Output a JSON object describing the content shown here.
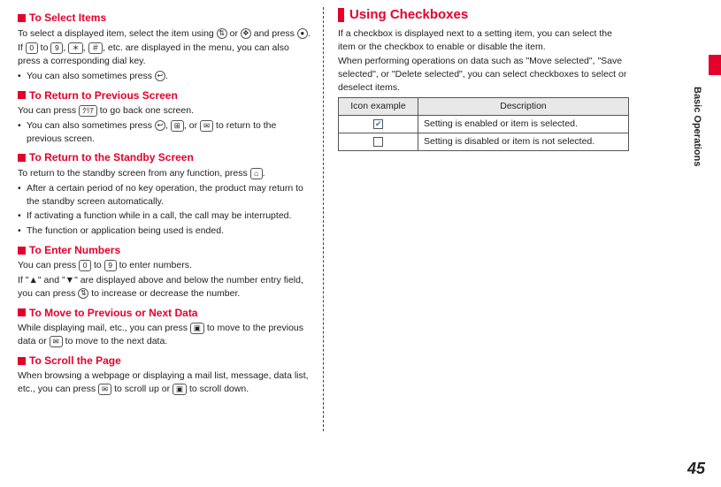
{
  "left": {
    "s1": {
      "title": "To Select Items",
      "p1a": "To select a displayed item, select the item using ",
      "p1b": " or ",
      "p1c": " and press ",
      "p1d": ".",
      "p2a": "If ",
      "p2b": " to ",
      "p2c": ", ",
      "p2d": ", ",
      "p2e": ", etc. are displayed in the menu, you can also press a corresponding dial key.",
      "b1": "You can also sometimes press ",
      "b1b": "."
    },
    "s2": {
      "title": "To Return to Previous Screen",
      "p1a": "You can press ",
      "p1b": " to go back one screen.",
      "b1a": "You can also sometimes press ",
      "b1b": ", ",
      "b1c": ", or ",
      "b1d": " to return to the previous screen."
    },
    "s3": {
      "title": "To Return to the Standby Screen",
      "p1a": "To return to the standby screen from any function, press ",
      "p1b": ".",
      "b1": "After a certain period of no key operation, the product may return to the standby screen automatically.",
      "b2": "If activating a function while in a call, the call may be interrupted.",
      "b3": "The function or application being used is ended."
    },
    "s4": {
      "title": "To Enter Numbers",
      "p1a": "You can press ",
      "p1b": " to ",
      "p1c": " to enter numbers.",
      "p2a": "If \"▲\" and \"▼\" are displayed above and below the number entry field, you can press ",
      "p2b": " to increase or decrease the number."
    },
    "s5": {
      "title": "To Move to Previous or Next Data",
      "p1a": "While displaying mail, etc., you can press ",
      "p1b": " to move to the previous data or ",
      "p1c": " to move to the next data."
    },
    "s6": {
      "title": "To Scroll the Page",
      "p1a": "When browsing a webpage or displaying a mail list, message, data list, etc., you can press ",
      "p1b": " to scroll up or ",
      "p1c": " to scroll down."
    }
  },
  "right": {
    "title": "Using Checkboxes",
    "p1": "If a checkbox is displayed next to a setting item, you can select the item or the checkbox to enable or disable the item.",
    "p2": "When performing operations on data such as \"Move selected\", \"Save selected\", or \"Delete selected\", you can select checkboxes to select or deselect items.",
    "th1": "Icon example",
    "th2": "Description",
    "r1": "Setting is enabled or item is selected.",
    "r2": "Setting is disabled or item is not selected."
  },
  "keys": {
    "zero": "0",
    "nine": "9",
    "star": "＊",
    "hash": "＃",
    "clear": "ｸﾘｱ",
    "end": "⌂",
    "updown": "⇅",
    "multi": "✥",
    "center": "●",
    "back": "↩",
    "cam": "▣",
    "mail": "✉",
    "app": "⊞"
  },
  "side": "Basic Operations",
  "page": "45"
}
